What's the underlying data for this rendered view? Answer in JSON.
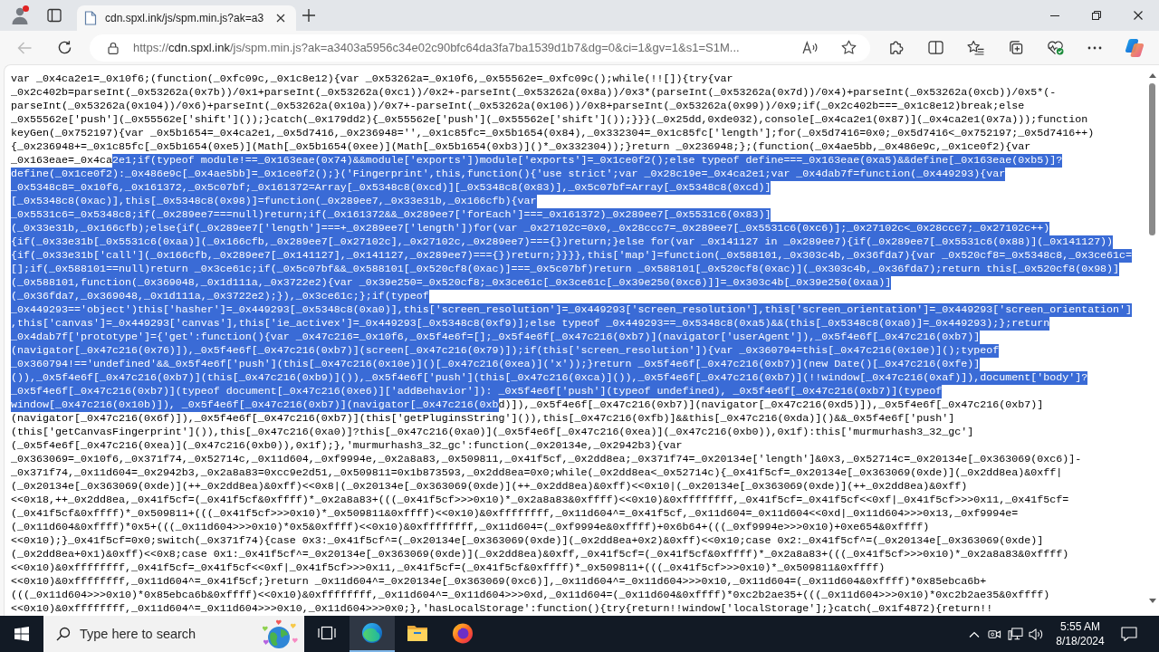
{
  "browser": {
    "profile": {
      "alert": true
    },
    "tabs": [
      {
        "title": "cdn.spxl.ink/js/spm.min.js?ak=a3",
        "selected": true
      }
    ],
    "back_button": {
      "disabled": true
    },
    "address_bar": {
      "url": {
        "scheme": "https://",
        "host": "cdn.spxl.ink",
        "path": "/js/spm.min.js?ak=a3403a5956c34e02c90bfc64da3fa7ba1539d1b7&dg=0&ci=1&gv=1&s1=S1M..."
      }
    }
  },
  "code": {
    "lines": [
      [
        {
          "text": "var _0x4ca2e1=_0x10f6;(function(_0xfc09c,_0x1c8e12){var _0x53262a=_0x10f6,_0x55562e=_0xfc09c();while(!![]){try{var",
          "selected": false
        }
      ],
      [
        {
          "text": "_0x2c402b=parseInt(_0x53262a(0x7b))/0x1+parseInt(_0x53262a(0xc1))/0x2+-parseInt(_0x53262a(0x8a))/0x3*(parseInt(_0x53262a(0x7d))/0x4)+parseInt(_0x53262a(0xcb))/0x5*(-",
          "selected": false
        }
      ],
      [
        {
          "text": "parseInt(_0x53262a(0x104))/0x6)+parseInt(_0x53262a(0x10a))/0x7+-parseInt(_0x53262a(0x106))/0x8+parseInt(_0x53262a(0x99))/0x9;if(_0x2c402b===_0x1c8e12)break;else",
          "selected": false
        }
      ],
      [
        {
          "text": "_0x55562e['push'](_0x55562e['shift']());}catch(_0x179dd2){_0x55562e['push'](_0x55562e['shift']());}}}(_0x25dd,0xde032),console[_0x4ca2e1(0x87)](_0x4ca2e1(0x7a)));function",
          "selected": false
        }
      ],
      [
        {
          "text": "keyGen(_0x752197){var _0x5b1654=_0x4ca2e1,_0x5d7416,_0x236948='',_0x1c85fc=_0x5b1654(0x84),_0x332304=_0x1c85fc['length'];for(_0x5d7416=0x0;_0x5d7416<_0x752197;_0x5d7416++)",
          "selected": false
        }
      ],
      [
        {
          "text": "{_0x236948+=_0x1c85fc[_0x5b1654(0xe5)](Math[_0x5b1654(0xee)](Math[_0x5b1654(0xb3)]()*_0x332304));}return _0x236948;};(function(_0x4ae5bb,_0x486e9c,_0x1ce0f2){var",
          "selected": false
        }
      ],
      [
        {
          "text": "_0x163eae=_0x4ca",
          "selected": false
        },
        {
          "text": "2e1;if(typeof module!==_0x163eae(0x74)&&module['exports'])module['exports']=_0x1ce0f2();else typeof define===_0x163eae(0xa5)&&define[_0x163eae(0xb5)]?",
          "selected": true
        }
      ],
      [
        {
          "text": "define(_0x1ce0f2):_0x486e9c[_0x4ae5bb]=_0x1ce0f2();}('Fingerprint',this,function(){'use strict';var _0x28c19e=_0x4ca2e1;var _0x4dab7f=function(_0x449293){var",
          "selected": true
        }
      ],
      [
        {
          "text": "_0x5348c8=_0x10f6,_0x161372,_0x5c07bf;_0x161372=Array[_0x5348c8(0xcd)][_0x5348c8(0x83)],_0x5c07bf=Array[_0x5348c8(0xcd)]",
          "selected": true
        }
      ],
      [
        {
          "text": "[_0x5348c8(0xac)],this[_0x5348c8(0x98)]=function(_0x289ee7,_0x33e31b,_0x166cfb){var",
          "selected": true
        }
      ],
      [
        {
          "text": "_0x5531c6=_0x5348c8;if(_0x289ee7===null)return;if(_0x161372&&_0x289ee7['forEach']===_0x161372)_0x289ee7[_0x5531c6(0x83)]",
          "selected": true
        }
      ],
      [
        {
          "text": "(_0x33e31b,_0x166cfb);else{if(_0x289ee7['length']===+_0x289ee7['length'])for(var _0x27102c=0x0,_0x28ccc7=_0x289ee7[_0x5531c6(0xc6)];_0x27102c<_0x28ccc7;_0x27102c++)",
          "selected": true
        }
      ],
      [
        {
          "text": "{if(_0x33e31b[_0x5531c6(0xaa)](_0x166cfb,_0x289ee7[_0x27102c],_0x27102c,_0x289ee7)==={})return;}else for(var _0x141127 in _0x289ee7){if(_0x289ee7[_0x5531c6(0x88)](_0x141127))",
          "selected": true
        }
      ],
      [
        {
          "text": "{if(_0x33e31b['call'](_0x166cfb,_0x289ee7[_0x141127],_0x141127,_0x289ee7)==={})return;}}}},this['map']=function(_0x588101,_0x303c4b,_0x36fda7){var _0x520cf8=_0x5348c8,_0x3ce61c=",
          "selected": true
        }
      ],
      [
        {
          "text": "[];if(_0x588101==null)return _0x3ce61c;if(_0x5c07bf&&_0x588101[_0x520cf8(0xac)]===_0x5c07bf)return _0x588101[_0x520cf8(0xac)](_0x303c4b,_0x36fda7);return this[_0x520cf8(0x98)]",
          "selected": true
        }
      ],
      [
        {
          "text": "(_0x588101,function(_0x369048,_0x1d111a,_0x3722e2){var _0x39e250=_0x520cf8;_0x3ce61c[_0x3ce61c[_0x39e250(0xc6)]]=_0x303c4b[_0x39e250(0xaa)]",
          "selected": true
        }
      ],
      [
        {
          "text": "(_0x36fda7,_0x369048,_0x1d111a,_0x3722e2);}),_0x3ce61c;};if(typeof",
          "selected": true
        }
      ],
      [
        {
          "text": "_0x449293=='object')this['hasher']=_0x449293[_0x5348c8(0xa0)],this['screen_resolution']=_0x449293['screen_resolution'],this['screen_orientation']=_0x449293['screen_orientation']",
          "selected": true
        }
      ],
      [
        {
          "text": ",this['canvas']=_0x449293['canvas'],this['ie_activex']=_0x449293[_0x5348c8(0xf9)];else typeof _0x449293==_0x5348c8(0xa5)&&(this[_0x5348c8(0xa0)]=_0x449293);};return",
          "selected": true
        }
      ],
      [
        {
          "text": "_0x4dab7f['prototype']={'get':function(){var _0x47c216=_0x10f6,_0x5f4e6f=[];_0x5f4e6f[_0x47c216(0xb7)](navigator['userAgent']),_0x5f4e6f[_0x47c216(0xb7)]",
          "selected": true
        }
      ],
      [
        {
          "text": "(navigator[_0x47c216(0x76)]),_0x5f4e6f[_0x47c216(0xb7)](screen[_0x47c216(0x79)]);if(this['screen_resolution']){var _0x360794=this[_0x47c216(0x10e)]();typeof",
          "selected": true
        }
      ],
      [
        {
          "text": "_0x360794!=='undefined'&&_0x5f4e6f['push'](this[_0x47c216(0x10e)]()[_0x47c216(0xea)]('x'));}return _0x5f4e6f[_0x47c216(0xb7)](new Date()[_0x47c216(0xfe)]",
          "selected": true
        }
      ],
      [
        {
          "text": "()),_0x5f4e6f[_0x47c216(0xb7)](this[_0x47c216(0xb9)]()),_0x5f4e6f['push'](this[_0x47c216(0xca)]()),_0x5f4e6f[_0x47c216(0xb7)](!!window[_0x47c216(0xaf)]),document['body']?",
          "selected": true
        }
      ],
      [
        {
          "text": "_0x5f4e6f[_0x47c216(0xb7)](typeof document[_0x47c216(0xe6)]['addBehavior']): _0x5f4e6f['push'](typeof undefined), _0x5f4e6f[_0x47c216(0xb7)](typeof",
          "selected": true
        }
      ],
      [
        {
          "text": "window[_0x47c216(0x10b)]), _0x5f4e6f[_0x47c216(0xb7)](navigator[_0x47c216(0xb",
          "selected": true
        },
        {
          "text": "d)]),_0x5f4e6f[_0x47c216(0xb7)](navigator[_0x47c216(0xd5)]),_0x5f4e6f[_0x47c216(0xb7)]",
          "selected": false
        }
      ],
      [
        {
          "text": "(navigator[_0x47c216(0x6f)]),_0x5f4e6f[_0x47c216(0xb7)](this['getPluginsString']()),this[_0x47c216(0xfb)]&&this[_0x47c216(0xda)]()&&_0x5f4e6f['push']",
          "selected": false
        }
      ],
      [
        {
          "text": "(this['getCanvasFingerprint']()),this[_0x47c216(0xa0)]?this[_0x47c216(0xa0)](_0x5f4e6f[_0x47c216(0xea)](_0x47c216(0xb0)),0x1f):this['murmurhash3_32_gc']",
          "selected": false
        }
      ],
      [
        {
          "text": "(_0x5f4e6f[_0x47c216(0xea)](_0x47c216(0xb0)),0x1f);},'murmurhash3_32_gc':function(_0x20134e,_0x2942b3){var",
          "selected": false
        }
      ],
      [
        {
          "text": "_0x363069=_0x10f6,_0x371f74,_0x52714c,_0x11d604,_0xf9994e,_0x2a8a83,_0x509811,_0x41f5cf,_0x2dd8ea;_0x371f74=_0x20134e['length']&0x3,_0x52714c=_0x20134e[_0x363069(0xc6)]-",
          "selected": false
        }
      ],
      [
        {
          "text": "_0x371f74,_0x11d604=_0x2942b3,_0x2a8a83=0xcc9e2d51,_0x509811=0x1b873593,_0x2dd8ea=0x0;while(_0x2dd8ea<_0x52714c){_0x41f5cf=_0x20134e[_0x363069(0xde)](_0x2dd8ea)&0xff|",
          "selected": false
        }
      ],
      [
        {
          "text": "(_0x20134e[_0x363069(0xde)](++_0x2dd8ea)&0xff)<<0x8|(_0x20134e[_0x363069(0xde)](++_0x2dd8ea)&0xff)<<0x10|(_0x20134e[_0x363069(0xde)](++_0x2dd8ea)&0xff)",
          "selected": false
        }
      ],
      [
        {
          "text": "<<0x18,++_0x2dd8ea,_0x41f5cf=(_0x41f5cf&0xffff)*_0x2a8a83+(((_0x41f5cf>>>0x10)*_0x2a8a83&0xffff)<<0x10)&0xffffffff,_0x41f5cf=_0x41f5cf<<0xf|_0x41f5cf>>>0x11,_0x41f5cf=",
          "selected": false
        }
      ],
      [
        {
          "text": "(_0x41f5cf&0xffff)*_0x509811+(((_0x41f5cf>>>0x10)*_0x509811&0xffff)<<0x10)&0xffffffff,_0x11d604^=_0x41f5cf,_0x11d604=_0x11d604<<0xd|_0x11d604>>>0x13,_0xf9994e=",
          "selected": false
        }
      ],
      [
        {
          "text": "(_0x11d604&0xffff)*0x5+(((_0x11d604>>>0x10)*0x5&0xffff)<<0x10)&0xffffffff,_0x11d604=(_0xf9994e&0xffff)+0x6b64+(((_0xf9994e>>>0x10)+0xe654&0xffff)",
          "selected": false
        }
      ],
      [
        {
          "text": "<<0x10);}_0x41f5cf=0x0;switch(_0x371f74){case 0x3:_0x41f5cf^=(_0x20134e[_0x363069(0xde)](_0x2dd8ea+0x2)&0xff)<<0x10;case 0x2:_0x41f5cf^=(_0x20134e[_0x363069(0xde)]",
          "selected": false
        }
      ],
      [
        {
          "text": "(_0x2dd8ea+0x1)&0xff)<<0x8;case 0x1:_0x41f5cf^=_0x20134e[_0x363069(0xde)](_0x2dd8ea)&0xff,_0x41f5cf=(_0x41f5cf&0xffff)*_0x2a8a83+(((_0x41f5cf>>>0x10)*_0x2a8a83&0xffff)",
          "selected": false
        }
      ],
      [
        {
          "text": "<<0x10)&0xffffffff,_0x41f5cf=_0x41f5cf<<0xf|_0x41f5cf>>>0x11,_0x41f5cf=(_0x41f5cf&0xffff)*_0x509811+(((_0x41f5cf>>>0x10)*_0x509811&0xffff)",
          "selected": false
        }
      ],
      [
        {
          "text": "<<0x10)&0xffffffff,_0x11d604^=_0x41f5cf;}return _0x11d604^=_0x20134e[_0x363069(0xc6)],_0x11d604^=_0x11d604>>>0x10,_0x11d604=(_0x11d604&0xffff)*0x85ebca6b+",
          "selected": false
        }
      ],
      [
        {
          "text": "(((_0x11d604>>>0x10)*0x85ebca6b&0xffff)<<0x10)&0xffffffff,_0x11d604^=_0x11d604>>>0xd,_0x11d604=(_0x11d604&0xffff)*0xc2b2ae35+(((_0x11d604>>>0x10)*0xc2b2ae35&0xffff)",
          "selected": false
        }
      ],
      [
        {
          "text": "<<0x10)&0xffffffff,_0x11d604^=_0x11d604>>>0x10,_0x11d604>>>0x0;},'hasLocalStorage':function(){try{return!!window['localStorage'];}catch(_0x1f4872){return!!",
          "selected": false
        }
      ]
    ]
  },
  "taskbar": {
    "search": {
      "placeholder": "Type here to search"
    },
    "apps": [
      {
        "kind": "edge",
        "selected": true
      },
      {
        "kind": "explorer",
        "selected": false
      },
      {
        "kind": "firefox",
        "selected": false
      }
    ],
    "clock": {
      "time": "5:55 AM",
      "date": "8/18/2024"
    }
  }
}
